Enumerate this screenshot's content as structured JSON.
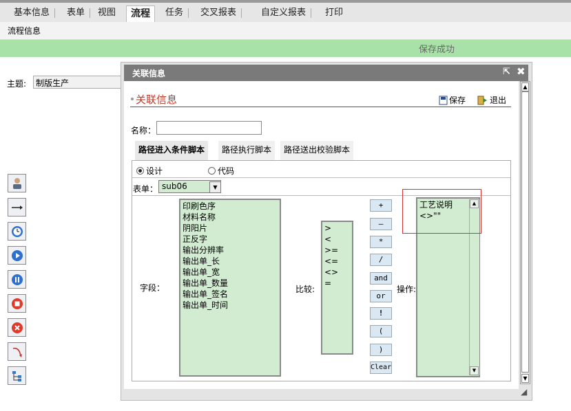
{
  "top_tabs": [
    "基本信息",
    "表单",
    "视图",
    "流程",
    "任务",
    "交叉报表",
    "自定义报表",
    "打印"
  ],
  "subbar_title": "流程信息",
  "status_message": "保存成功",
  "subject": {
    "label": "主题:",
    "value": "制版生产"
  },
  "dialog": {
    "title": "关联信息",
    "section_title": "关联信息",
    "save_label": "保存",
    "exit_label": "退出",
    "name_label": "名称：",
    "name_value": "",
    "tabs": [
      "路径进入条件脚本",
      "路径执行脚本",
      "路径送出校验脚本"
    ],
    "mode_design": "设计",
    "mode_code": "代码",
    "form_label": "表单：",
    "form_value": "sub06",
    "field_label": "字段：",
    "fields": [
      "印刷色序",
      "材料名称",
      "阴阳片",
      "正反字",
      "输出分辨率",
      "输出单_长",
      "输出单_宽",
      "输出单_数量",
      "输出单_签名",
      "输出单_时间"
    ],
    "compare_label": "比较:",
    "compare_ops": [
      ">",
      "<",
      ">=",
      "<=",
      "<>",
      "="
    ],
    "operators": [
      "+",
      "—",
      "*",
      "/",
      "and",
      "or",
      "!",
      "(",
      ")",
      "Clear"
    ],
    "operation_label": "操作:",
    "operation_lines": [
      "工艺说明",
      "<>\"\""
    ]
  },
  "colors": {
    "status_green": "#a8e2a8",
    "list_green": "#d2ecd2",
    "title_grey": "#7a7a7a",
    "highlight_red": "#d33333"
  }
}
